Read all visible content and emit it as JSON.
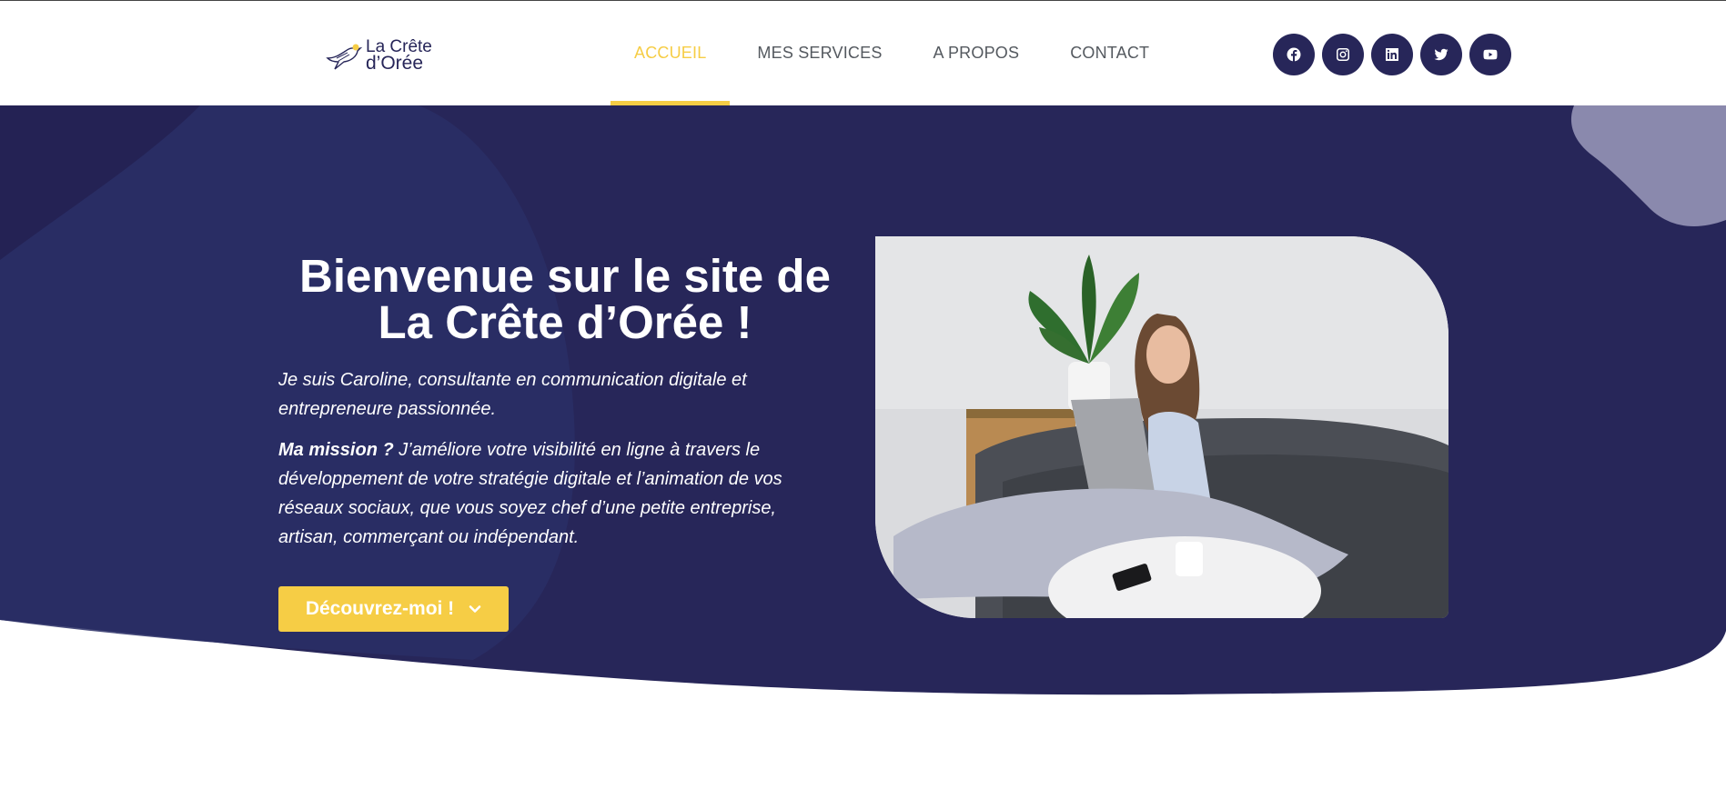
{
  "header": {
    "logo": {
      "line1": "La Crête",
      "line2": "d’Orée",
      "icon": "bird-logo-icon"
    },
    "nav": [
      {
        "label": "ACCUEIL",
        "active": true
      },
      {
        "label": "MES SERVICES",
        "active": false
      },
      {
        "label": "A PROPOS",
        "active": false
      },
      {
        "label": "CONTACT",
        "active": false
      }
    ],
    "social": [
      "facebook-icon",
      "instagram-icon",
      "linkedin-icon",
      "twitter-icon",
      "youtube-icon"
    ]
  },
  "hero": {
    "title_line1": "Bienvenue sur le site de",
    "title_line2": "La Crête d’Orée !",
    "intro": "Je suis Caroline, consultante en communication digitale et entrepreneure passionnée.",
    "mission_label": "Ma mission ?",
    "mission_text": " J’améliore votre visibilité en ligne à travers le développement de votre stratégie digitale et l’animation de vos réseaux sociaux, que vous soyez chef d’une petite entreprise, artisan, commerçant ou indépendant.",
    "cta_label": "Découvrez-moi !",
    "photo": "woman laughing on sofa with laptop"
  },
  "colors": {
    "navy": "#272659",
    "yellow": "#f6cd45",
    "nav_text": "#54595f",
    "blob": "#8a89ad"
  }
}
